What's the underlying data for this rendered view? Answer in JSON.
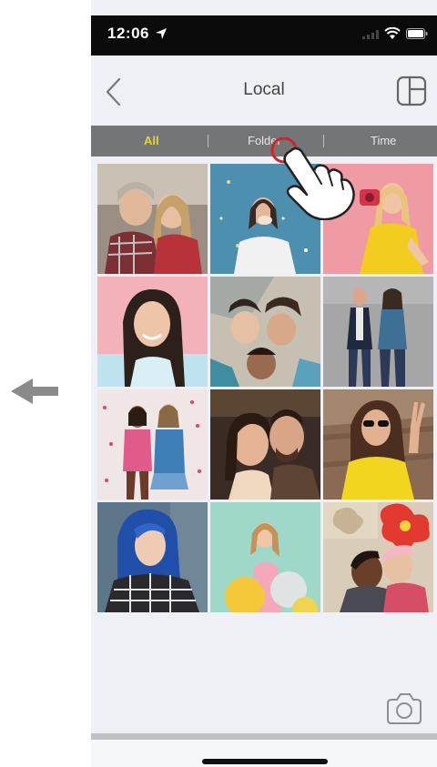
{
  "status": {
    "time": "12:06"
  },
  "nav": {
    "title": "Local"
  },
  "tabs": [
    {
      "label": "All",
      "selected": true
    },
    {
      "label": "Folder",
      "selected": false
    },
    {
      "label": "Time",
      "selected": false
    }
  ],
  "photos": [
    "friends-selfie",
    "confetti-girl",
    "girl-with-camera",
    "girl-smiling",
    "friends-lying",
    "couple-standing",
    "kids-confetti",
    "couple-selfie",
    "girl-peace-sign",
    "blue-hair-girl",
    "girl-with-balloons",
    "couple-flowers"
  ],
  "colors": {
    "accent": "#e8d23a",
    "tabbar": "#747577",
    "background": "#eef0f5",
    "tap_ring": "#d0252b"
  },
  "icons": {
    "left_arrow": "arrow-left-icon",
    "back": "chevron-left-icon",
    "layout": "layout-icon",
    "camera": "camera-icon",
    "hand": "hand-pointer-icon"
  }
}
